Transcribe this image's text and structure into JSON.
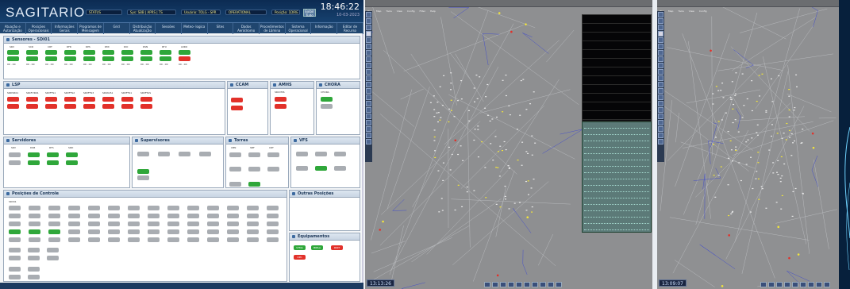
{
  "screen_a": {
    "logo": "SAGITARIO",
    "info_boxes": [
      "STATUS",
      "Sys: SBB | APRS | TS",
      "Usuário: TOLG - SPR",
      "OPERATIONAL",
      "Posição: 1DIRE"
    ],
    "clock": {
      "time": "18:46:22",
      "date": "10-03-2023"
    },
    "header_button": "Exibir Tudo",
    "nav": [
      "Atuação e Autorização",
      "Posições Operacionais",
      "Informações Gerais",
      "Programas de Mensagem",
      "Grid",
      "Distribuição Atualização",
      "Sessões",
      "Meteo- logica",
      "Sites",
      "Dados Aeródromo",
      "Procedimentos de Lâmina",
      "Sistema Operacional",
      "Informação",
      "Editar de Recurso"
    ],
    "sections": {
      "sensors": "Sensores - SDI01",
      "lsp": "LSP",
      "ccam": "CCAM",
      "amhs": "AMHS",
      "chora": "CHORA",
      "servidores": "Servidores",
      "supervisores": "Supervisores",
      "torres": "Torres",
      "vfs": "VFS",
      "posicoes": "Posições de Controle",
      "outras": "Outras Posições",
      "equipamentos": "Equipamentos"
    },
    "sensor_labels": [
      "SRV",
      "SCR",
      "CRT",
      "RFR",
      "RPS",
      "RMI",
      "RIO",
      "RSN",
      "RTU",
      "LRRO"
    ],
    "lsp_labels": [
      "SRDVR01",
      "SRCFVR01",
      "SRVFTS1",
      "SRVFTS2",
      "SRVFTS3",
      "SRVAVS1",
      "SRVFTS1",
      "SRVFTAS"
    ],
    "amhs_label": "SRCVMS",
    "chora_label": "CHORA",
    "server_labels": [
      "SRV",
      "DSB",
      "RTS",
      "SRD"
    ],
    "torre_labels": [
      "CBN",
      "SBF",
      "CRT",
      "SBS",
      "SDP"
    ],
    "equip_chips": [
      "STMA",
      "BIPAA",
      "PART",
      "OPC"
    ]
  },
  "screen_b": {
    "menu": [
      "File",
      "Map",
      "Tools",
      "View",
      "Config",
      "Filter",
      "Help"
    ],
    "time": "13:13:26"
  },
  "screen_c": {
    "menu": [
      "File",
      "Map",
      "Tools",
      "View",
      "Config"
    ],
    "time": "13:09:07"
  },
  "colors": {
    "ok": "#2fa73a",
    "alarm": "#e2312a",
    "idle": "#a9adb2",
    "header": "#0c2b52"
  }
}
